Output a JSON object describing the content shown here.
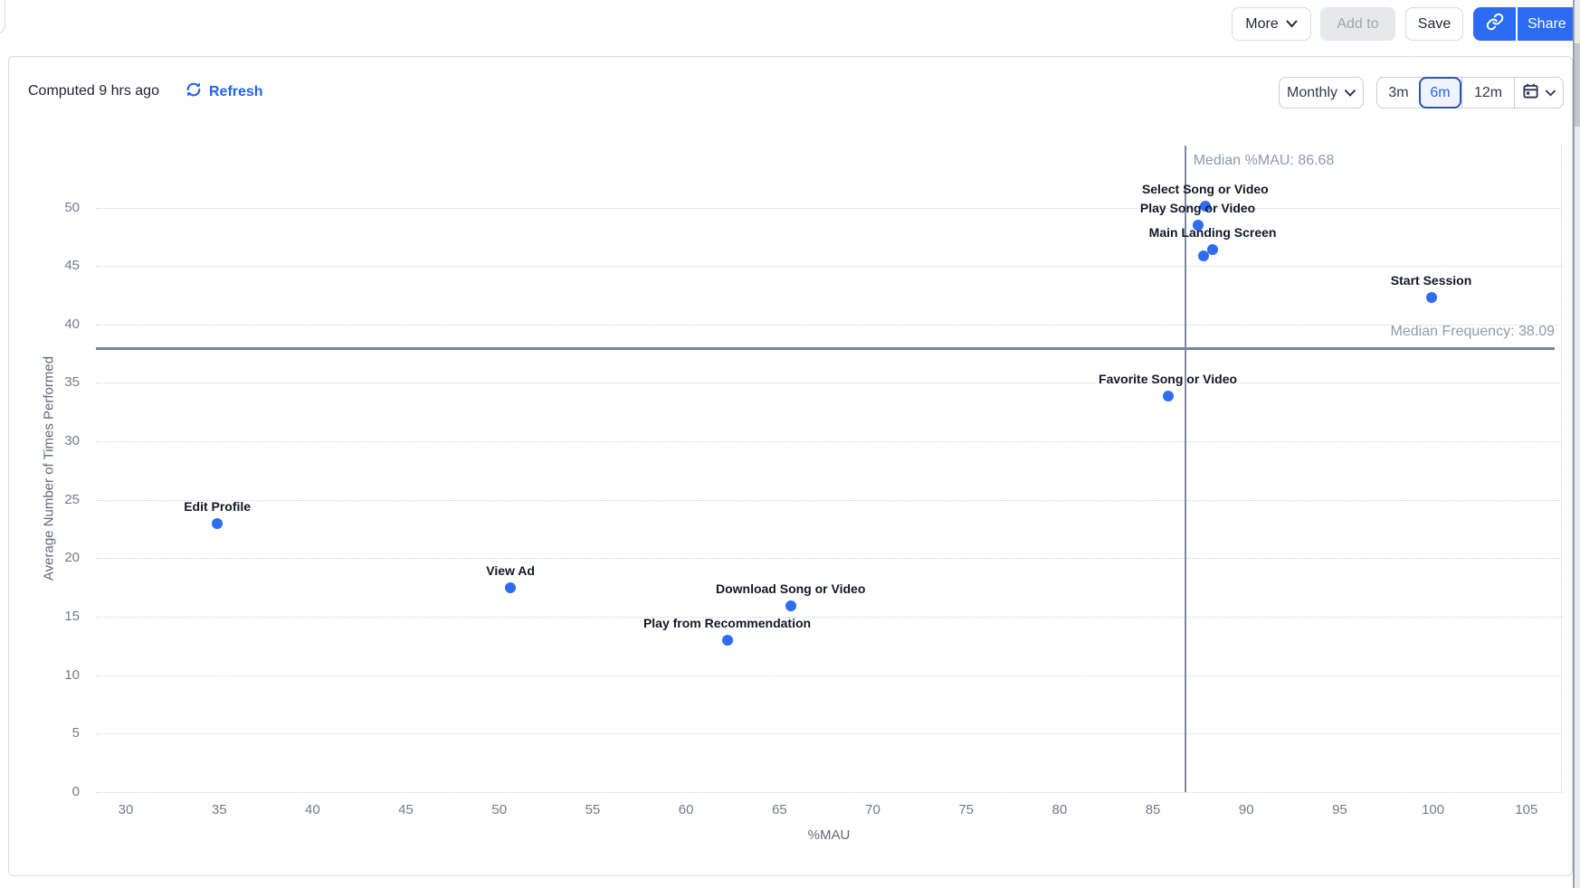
{
  "toolbar": {
    "more": "More",
    "add_to": "Add to",
    "save": "Save",
    "share": "Share"
  },
  "header": {
    "computed_text": "Computed 9 hrs ago",
    "refresh_label": "Refresh",
    "granularity_label": "Monthly",
    "ranges": [
      "3m",
      "6m",
      "12m"
    ],
    "selected_range": "6m"
  },
  "colors": {
    "accent_blue": "#2b6cf2",
    "refresh_blue": "#2563eb",
    "point_blue": "#2f6cf2",
    "median_line": "#7b8c9f",
    "median_text": "#8b9cb0"
  },
  "chart_data": {
    "type": "scatter",
    "title": "",
    "xlabel": "%MAU",
    "ylabel": "Average Number of Times Performed",
    "xlim": [
      28.4,
      106.9
    ],
    "ylim": [
      0,
      55.3
    ],
    "xticks": [
      30,
      35,
      40,
      45,
      50,
      55,
      60,
      65,
      70,
      75,
      80,
      85,
      90,
      95,
      100,
      105
    ],
    "yticks": [
      0,
      5,
      10,
      15,
      20,
      25,
      30,
      35,
      40,
      45,
      50
    ],
    "grid": "horizontal-dotted",
    "legend": "none",
    "medians": {
      "mau": 86.68,
      "mau_label": "Median %MAU: 86.68",
      "frequency": 38.09,
      "frequency_label": "Median Frequency: 38.09"
    },
    "points": [
      {
        "label": "Select Song or Video",
        "x": 87.8,
        "y": 50.1
      },
      {
        "label": "Play Song or Video",
        "x": 87.4,
        "y": 48.5
      },
      {
        "label": "Main Landing Screen",
        "x": 88.2,
        "y": 46.4
      },
      {
        "label": "",
        "x": 87.7,
        "y": 45.9
      },
      {
        "label": "Start Session",
        "x": 99.9,
        "y": 42.3
      },
      {
        "label": "Favorite Song or Video",
        "x": 85.8,
        "y": 33.9
      },
      {
        "label": "Edit Profile",
        "x": 34.9,
        "y": 23
      },
      {
        "label": "View Ad",
        "x": 50.6,
        "y": 17.5
      },
      {
        "label": "Download Song or Video",
        "x": 65.6,
        "y": 15.9
      },
      {
        "label": "Play from Recommendation",
        "x": 62.2,
        "y": 13
      }
    ]
  }
}
